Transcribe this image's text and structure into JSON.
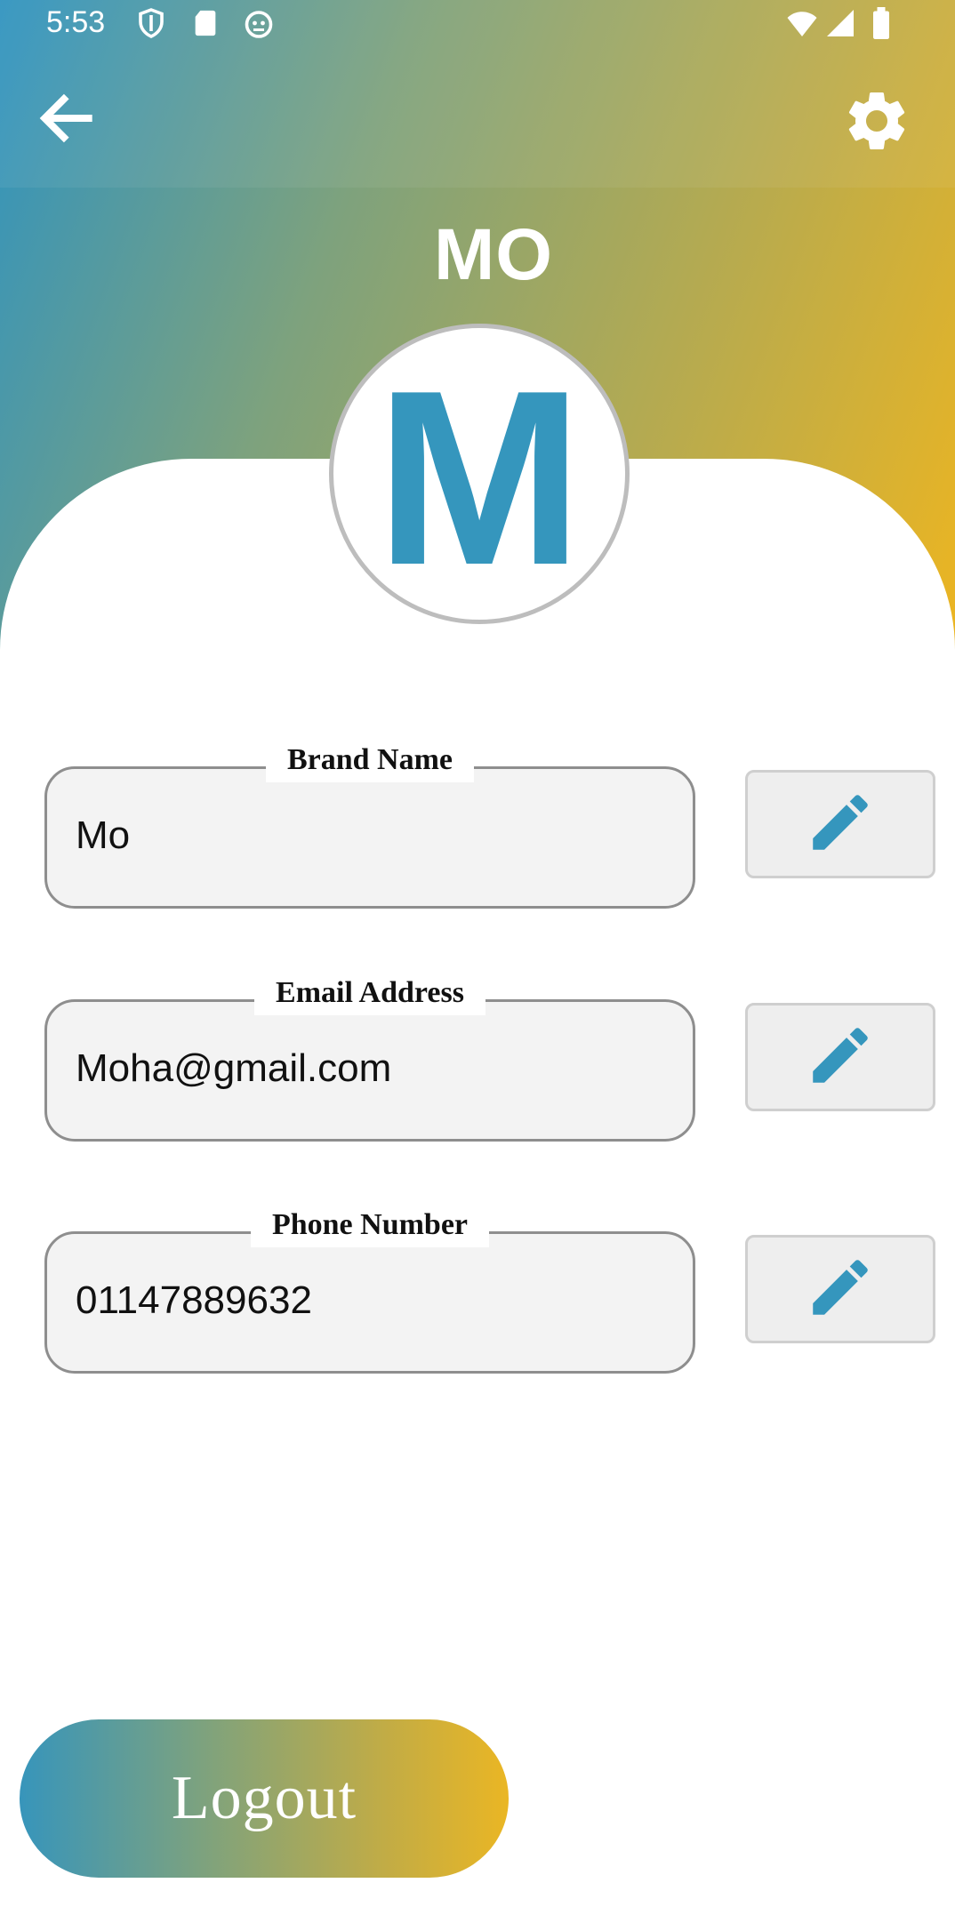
{
  "status_bar": {
    "time": "5:53",
    "left_icons": [
      "shield-icon",
      "sd-card-icon",
      "cat-face-icon"
    ],
    "right_icons": [
      "wifi-icon",
      "signal-icon",
      "battery-icon"
    ]
  },
  "app_bar": {
    "back_icon": "arrow-left-icon",
    "settings_icon": "gear-icon"
  },
  "profile": {
    "title": "MO",
    "avatar_letter": "M"
  },
  "fields": [
    {
      "label": "Brand Name",
      "value": "Mo",
      "edit_icon": "pencil-icon"
    },
    {
      "label": "Email Address",
      "value": "Moha@gmail.com",
      "edit_icon": "pencil-icon"
    },
    {
      "label": "Phone Number",
      "value": "01147889632",
      "edit_icon": "pencil-icon"
    }
  ],
  "logout": {
    "label": "Logout"
  },
  "colors": {
    "gradient_start": "#2f93c0",
    "gradient_end": "#ecb521",
    "accent_blue": "#3596bd",
    "field_background": "#f3f3f3"
  }
}
